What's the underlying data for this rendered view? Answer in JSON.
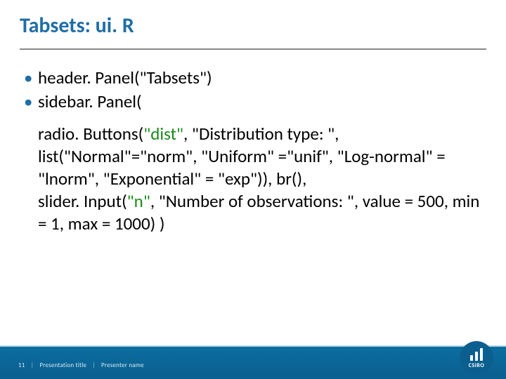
{
  "slide": {
    "title": "Tabsets: ui. R",
    "bullets": [
      "header. Panel(\"Tabsets\")",
      "sidebar. Panel("
    ],
    "body_pre": "radio. Buttons(",
    "body_green1": "\"dist\"",
    "body_mid1": ", \"Distribution type: \", list(\"Normal\"=\"norm\", \"Uniform\" =\"unif\", \"Log-normal\" = \"lnorm\",   \"Exponential\" = \"exp\")), br(),",
    "body_line3_pre": "slider. Input(",
    "body_green2": "\"n\"",
    "body_mid2": ", \"Number of observations: \", value = 500, min = 1, max = 1000) )"
  },
  "footer": {
    "page": "11",
    "title": "Presentation title",
    "presenter": "Presenter name",
    "logo": "CSIRO"
  }
}
